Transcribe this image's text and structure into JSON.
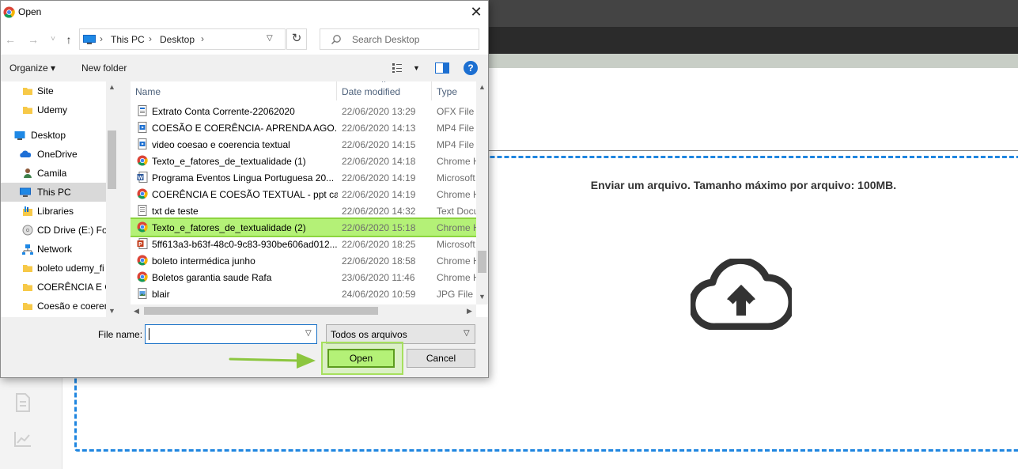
{
  "dialog": {
    "title": "Open",
    "close_glyph": "✕",
    "nav": {
      "back": "←",
      "forward": "→",
      "recent": "˅",
      "up": "↑",
      "address_segments": [
        "This PC",
        "Desktop"
      ],
      "refresh": "↻",
      "search_placeholder": "Search Desktop"
    },
    "toolbar": {
      "organize": "Organize ▾",
      "new_folder": "New folder",
      "help": "?"
    },
    "nav_pane": [
      {
        "label": "Site",
        "icon": "folder-icon"
      },
      {
        "label": "Udemy",
        "icon": "folder-icon"
      },
      {
        "label": "Desktop",
        "icon": "desktop-icon"
      },
      {
        "label": "OneDrive",
        "icon": "onedrive-icon"
      },
      {
        "label": "Camila",
        "icon": "user-icon"
      },
      {
        "label": "This PC",
        "icon": "computer-icon"
      },
      {
        "label": "Libraries",
        "icon": "libraries-icon"
      },
      {
        "label": "CD Drive (E:) Foc",
        "icon": "cd-drive-icon"
      },
      {
        "label": "Network",
        "icon": "network-icon"
      },
      {
        "label": "boleto udemy_fi",
        "icon": "folder-icon"
      },
      {
        "label": "COERÊNCIA E CO",
        "icon": "folder-icon"
      },
      {
        "label": "Coesão e coeren",
        "icon": "folder-icon"
      }
    ],
    "columns": {
      "name": "Name",
      "date": "Date modified",
      "type": "Type"
    },
    "files": [
      {
        "name": "Extrato Conta Corrente-22062020",
        "date": "22/06/2020 13:29",
        "type": "OFX File",
        "icon": "document-icon"
      },
      {
        "name": "COESÃO E COERÊNCIA- APRENDA AGO...",
        "date": "22/06/2020 14:13",
        "type": "MP4 File",
        "icon": "video-icon"
      },
      {
        "name": "video coesao e coerencia textual",
        "date": "22/06/2020 14:15",
        "type": "MP4 File",
        "icon": "video-icon"
      },
      {
        "name": "Texto_e_fatores_de_textualidade (1)",
        "date": "22/06/2020 14:18",
        "type": "Chrome H",
        "icon": "chrome-icon"
      },
      {
        "name": "Programa Eventos Lingua Portuguesa 20...",
        "date": "22/06/2020 14:19",
        "type": "Microsoft",
        "icon": "word-icon"
      },
      {
        "name": "COERÊNCIA E COESÃO TEXTUAL - ppt ca...",
        "date": "22/06/2020 14:19",
        "type": "Chrome H",
        "icon": "chrome-icon"
      },
      {
        "name": "txt de teste",
        "date": "22/06/2020 14:32",
        "type": "Text Docu",
        "icon": "text-file-icon"
      },
      {
        "name": "Texto_e_fatores_de_textualidade (2)",
        "date": "22/06/2020 15:18",
        "type": "Chrome H",
        "icon": "chrome-icon",
        "selected": true
      },
      {
        "name": "5ff613a3-b63f-48c0-9c83-930be606ad012...",
        "date": "22/06/2020 18:25",
        "type": "Microsoft",
        "icon": "powerpoint-icon"
      },
      {
        "name": "boleto intermédica junho",
        "date": "22/06/2020 18:58",
        "type": "Chrome H",
        "icon": "chrome-icon"
      },
      {
        "name": "Boletos garantia saude Rafa",
        "date": "23/06/2020 11:46",
        "type": "Chrome H",
        "icon": "chrome-icon"
      },
      {
        "name": "blair",
        "date": "24/06/2020 10:59",
        "type": "JPG File",
        "icon": "image-icon"
      }
    ],
    "filename_label": "File name:",
    "filename_value": "",
    "filetype": "Todos os arquivos",
    "open_label": "Open",
    "cancel_label": "Cancel"
  },
  "page": {
    "upload_text": "Enviar um arquivo. Tamanho máximo por arquivo: 100MB.",
    "upload_icon": "cloud-upload-icon",
    "accent_color": "#1f86e0",
    "highlight_color": "#b4f177"
  }
}
